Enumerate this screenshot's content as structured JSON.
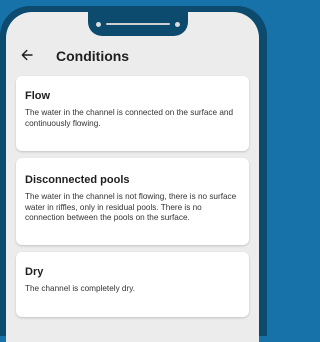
{
  "header": {
    "title": "Conditions",
    "back_icon": "arrow-left-icon"
  },
  "colors": {
    "background": "#1672a8",
    "phone_frame": "#0c4a6e",
    "screen": "#ececec",
    "card": "#ffffff"
  },
  "conditions": [
    {
      "title": "Flow",
      "description": "The water in the channel is connected on the surface and continuously flowing."
    },
    {
      "title": "Disconnected pools",
      "description": "The water in the channel is not flowing, there is no surface water in riffles, only in residual pools. There is no connection between the pools on the surface."
    },
    {
      "title": "Dry",
      "description": "The channel is completely dry."
    }
  ]
}
